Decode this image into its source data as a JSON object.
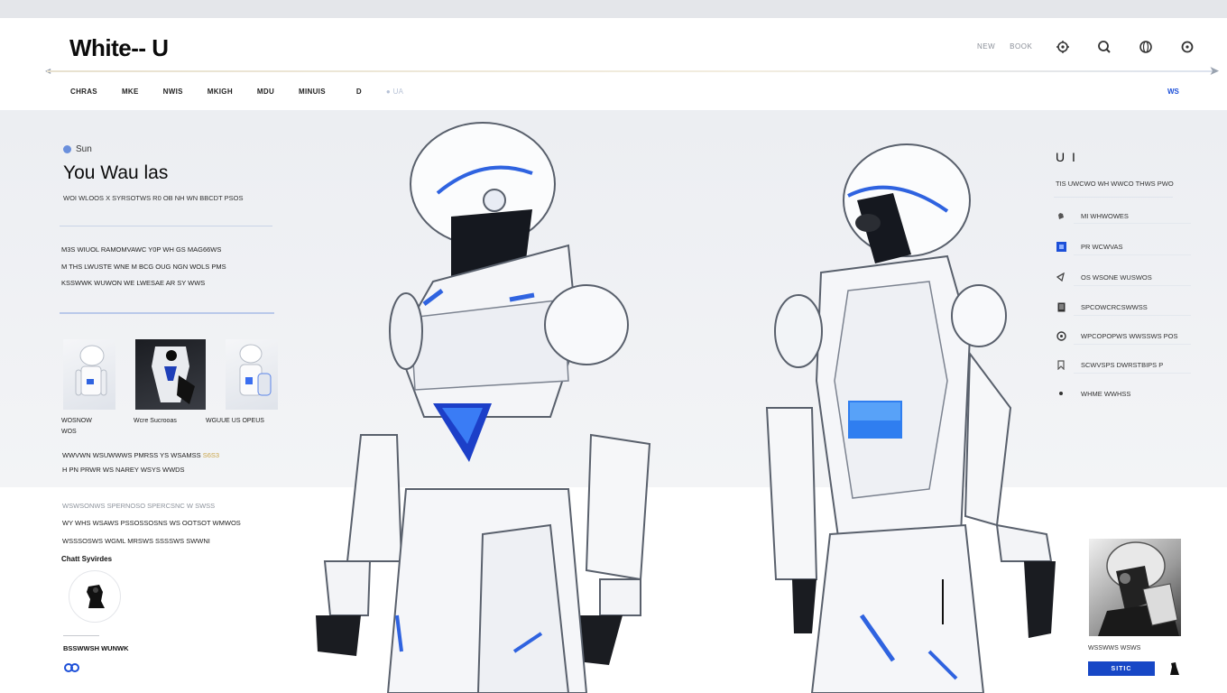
{
  "app": {
    "logo": "White-- U"
  },
  "header": {
    "links": [
      "NEW",
      "BOOK"
    ],
    "icons": [
      "settings-icon",
      "search-icon",
      "globe-icon",
      "profile-icon"
    ]
  },
  "nav": {
    "items": [
      "CHRAS",
      "MKE",
      "NWIS",
      "MKIGH",
      "MDU",
      "MINUIS",
      "D",
      "● UA"
    ],
    "right_link": "WS"
  },
  "hero": {
    "tag": "Sun",
    "headline": "You Wau las",
    "subline": "WOI WLOOS X SYRSOTWS R0 OB NH WN BBCDT PSOS",
    "paragraph": [
      "M3S WIUOL   RAMOMVAWC Y0P WH GS MAG66WS",
      "M THS LWUSTE WNE M BCG OUG NGN WOLS PMS",
      "KSSWWK WUWON WE LWESAE AR SY WWS"
    ]
  },
  "thumbnails": {
    "captions": [
      [
        "WOSNOW",
        "WOS"
      ],
      [
        "Wcre Sucrooas"
      ],
      [
        "WGUUE US OPEUS"
      ]
    ]
  },
  "left_lines": [
    {
      "text": "WWVWN WSUWWWS PMRSS  YS WSAMSS",
      "accent": "S6S3"
    },
    {
      "text": "H PN PRWR WS NAREY WSYS WWDS",
      "accent": ""
    },
    {
      "text": "WSWSONWS  SPERNOSO  SPERCSNC W  SWSS",
      "accent": ""
    },
    {
      "text": "WY WHS WSAWS  PSSOSSOSNS WS  OOTSOT WMWOS",
      "accent": ""
    },
    {
      "text": "WSSSOSWS WGML  MRSWS  SSSSWS  SWWNI",
      "accent": ""
    }
  ],
  "left_section": {
    "label": "Chatt Syvirdes",
    "foot_label": "BSSWWSH WUNWK"
  },
  "right_panel": {
    "title": "U I",
    "subtitle": "TIS UWCWO WH WWCO THWS PWO",
    "items": [
      {
        "icon": "hand-icon",
        "label": "MI WHWOWES"
      },
      {
        "icon": "badge-icon",
        "label": "PR WCWVAS"
      },
      {
        "icon": "cursor-icon",
        "label": "OS WSONE WUSWOS"
      },
      {
        "icon": "document-icon",
        "label": "SPCOWCRCSWWSS"
      },
      {
        "icon": "clock-icon",
        "label": "WPCOPOPWS WWSSWS POS"
      },
      {
        "icon": "bookmark-icon",
        "label": "SCWVSPS DWRSTBIPS P"
      },
      {
        "icon": "dot-icon",
        "label": "WHME WWHSS"
      }
    ]
  },
  "promo": {
    "caption": "WSSWWS WSWS",
    "cta_label": "SITIC"
  },
  "colors": {
    "accent": "#1c4fd8",
    "cta": "#1747c6",
    "gold": "#c9a54a"
  }
}
